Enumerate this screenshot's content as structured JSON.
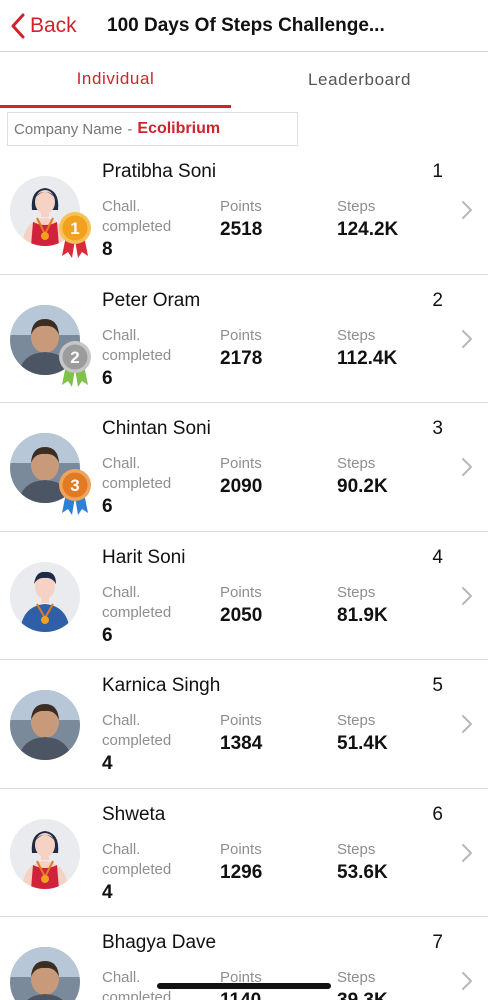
{
  "header": {
    "back_label": "Back",
    "title": "100 Days Of Steps Challenge..."
  },
  "tabs": [
    {
      "label": "Individual",
      "active": true
    },
    {
      "label": "Leaderboard",
      "active": false
    }
  ],
  "company": {
    "label": "Company Name",
    "separator": "-",
    "value": "Ecolibrium"
  },
  "labels": {
    "chall": "Chall. completed",
    "points": "Points",
    "steps": "Steps"
  },
  "colors": {
    "accent": "#d0232c",
    "gold": "#f1a11d",
    "silver": "#9c9c9c",
    "bronze": "#e07a23"
  },
  "participants": [
    {
      "name": "Pratibha Soni",
      "rank": "1",
      "chall": "8",
      "points": "2518",
      "steps": "124.2K",
      "avatar": "female-placeholder-avatar",
      "badge": "gold-medal-icon"
    },
    {
      "name": "Peter Oram",
      "rank": "2",
      "chall": "6",
      "points": "2178",
      "steps": "112.4K",
      "avatar": "photo-avatar",
      "badge": "silver-medal-icon"
    },
    {
      "name": "Chintan Soni",
      "rank": "3",
      "chall": "6",
      "points": "2090",
      "steps": "90.2K",
      "avatar": "photo-avatar",
      "badge": "bronze-medal-icon"
    },
    {
      "name": "Harit Soni",
      "rank": "4",
      "chall": "6",
      "points": "2050",
      "steps": "81.9K",
      "avatar": "male-placeholder-avatar",
      "badge": ""
    },
    {
      "name": "Karnica Singh",
      "rank": "5",
      "chall": "4",
      "points": "1384",
      "steps": "51.4K",
      "avatar": "photo-avatar",
      "badge": ""
    },
    {
      "name": "Shweta",
      "rank": "6",
      "chall": "4",
      "points": "1296",
      "steps": "53.6K",
      "avatar": "female-placeholder-avatar",
      "badge": ""
    },
    {
      "name": "Bhagya Dave",
      "rank": "7",
      "chall": "",
      "points": "1140",
      "steps": "39.3K",
      "avatar": "photo-avatar",
      "badge": ""
    }
  ]
}
